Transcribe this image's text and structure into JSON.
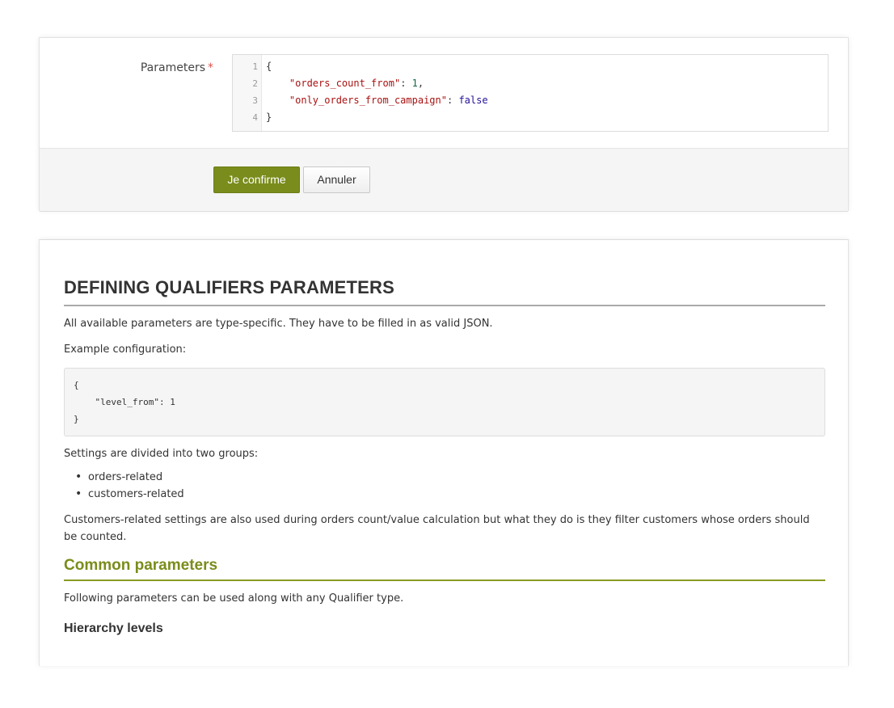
{
  "form": {
    "parameters_label": "Parameters",
    "required_marker": "*",
    "editor_lines": [
      {
        "n": "1",
        "parts": [
          {
            "t": "{",
            "c": ""
          }
        ]
      },
      {
        "n": "2",
        "parts": [
          {
            "t": "    ",
            "c": ""
          },
          {
            "t": "\"orders_count_from\"",
            "c": "str"
          },
          {
            "t": ": ",
            "c": ""
          },
          {
            "t": "1",
            "c": "num"
          },
          {
            "t": ",",
            "c": ""
          }
        ]
      },
      {
        "n": "3",
        "parts": [
          {
            "t": "    ",
            "c": ""
          },
          {
            "t": "\"only_orders_from_campaign\"",
            "c": "str"
          },
          {
            "t": ": ",
            "c": ""
          },
          {
            "t": "false",
            "c": "kw"
          }
        ]
      },
      {
        "n": "4",
        "parts": [
          {
            "t": "}",
            "c": ""
          }
        ]
      }
    ],
    "confirm_label": "Je confirme",
    "cancel_label": "Annuler"
  },
  "doc": {
    "title": "DEFINING QUALIFIERS PARAMETERS",
    "intro": "All available parameters are type-specific. They have to be filled in as valid JSON.",
    "example_label": "Example configuration:",
    "example_code": "{\n    \"level_from\": 1\n}",
    "groups_intro": "Settings are divided into two groups:",
    "groups": [
      "orders-related",
      "customers-related"
    ],
    "customers_note": "Customers-related settings are also used during orders count/value calculation but what they do is they filter customers whose orders should be counted.",
    "common_title": "Common parameters",
    "common_intro": "Following parameters can be used along with any Qualifier type.",
    "hierarchy_title": "Hierarchy levels"
  },
  "colors": {
    "accent": "#7a8c1b",
    "required": "#d9534f"
  }
}
